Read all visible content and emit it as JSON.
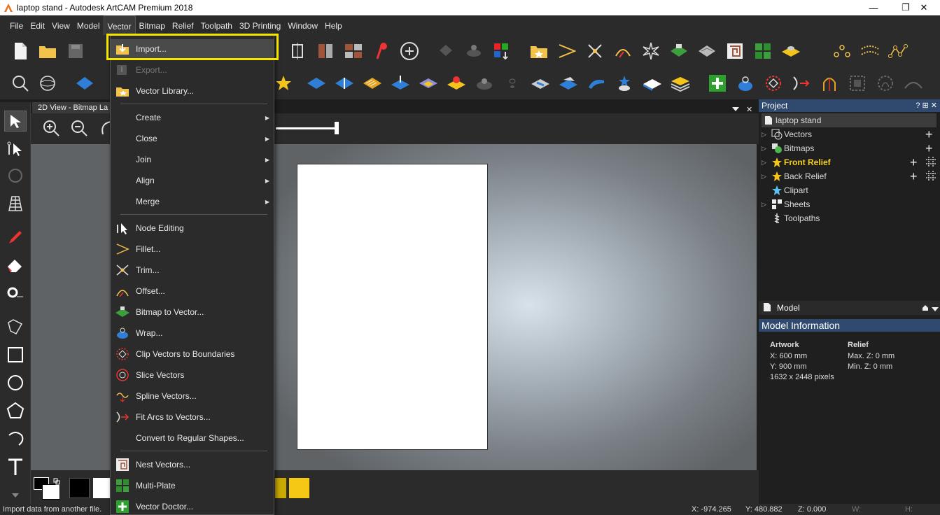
{
  "window": {
    "title": "laptop stand - Autodesk ArtCAM Premium 2018",
    "minimize": "—",
    "restore": "❐",
    "close": "✕"
  },
  "menubar": [
    "File",
    "Edit",
    "View",
    "Model",
    "Vector",
    "Bitmap",
    "Relief",
    "Toolpath",
    "3D Printing",
    "Window",
    "Help"
  ],
  "view": {
    "tab_label": "2D View - Bitmap La",
    "close_glyph": "✕"
  },
  "vector_menu": {
    "items": [
      {
        "label": "Import...",
        "icon": "import-icon",
        "enabled": true
      },
      {
        "label": "Export...",
        "icon": "export-icon",
        "enabled": false
      },
      {
        "label": "Vector Library...",
        "icon": "vector-library-icon",
        "enabled": true
      },
      {
        "label": "Create",
        "submenu": true
      },
      {
        "label": "Close",
        "submenu": true
      },
      {
        "label": "Join",
        "submenu": true
      },
      {
        "label": "Align",
        "submenu": true
      },
      {
        "label": "Merge",
        "submenu": true
      },
      {
        "label": "Node Editing",
        "icon": "node-editing-icon"
      },
      {
        "label": "Fillet...",
        "icon": "fillet-icon"
      },
      {
        "label": "Trim...",
        "icon": "trim-icon"
      },
      {
        "label": "Offset...",
        "icon": "offset-icon"
      },
      {
        "label": "Bitmap to Vector...",
        "icon": "bitmap-to-vector-icon"
      },
      {
        "label": "Wrap...",
        "icon": "wrap-icon"
      },
      {
        "label": "Clip Vectors to Boundaries",
        "icon": "clip-vectors-icon"
      },
      {
        "label": "Slice Vectors",
        "icon": "slice-vectors-icon"
      },
      {
        "label": "Spline Vectors...",
        "icon": "spline-vectors-icon"
      },
      {
        "label": "Fit Arcs to Vectors...",
        "icon": "fit-arcs-icon"
      },
      {
        "label": "Convert to Regular Shapes..."
      },
      {
        "label": "Nest Vectors...",
        "icon": "nest-vectors-icon"
      },
      {
        "label": "Multi-Plate",
        "icon": "multi-plate-icon"
      },
      {
        "label": "Vector Doctor...",
        "icon": "vector-doctor-icon"
      }
    ],
    "highlight_color": "#f5e600"
  },
  "project": {
    "header": "Project",
    "header_controls": "? ⊞ ✕",
    "root": "laptop stand",
    "items": [
      "Vectors",
      "Bitmaps",
      "Front Relief",
      "Back Relief",
      "Clipart",
      "Sheets",
      "Toolpaths"
    ]
  },
  "model": {
    "header": "Model",
    "info_header": "Model Information",
    "artwork_label": "Artwork",
    "relief_label": "Relief",
    "x": "X: 600 mm",
    "y": "Y: 900 mm",
    "pixels": "1632 x 2448 pixels",
    "max_z": "Max. Z: 0 mm",
    "min_z": "Min. Z: 0 mm"
  },
  "status": {
    "message": "Import data from another file.",
    "x": "X: -974.265",
    "y": "Y: 480.882",
    "z": "Z: 0.000",
    "w": "W:",
    "h": "H:"
  }
}
